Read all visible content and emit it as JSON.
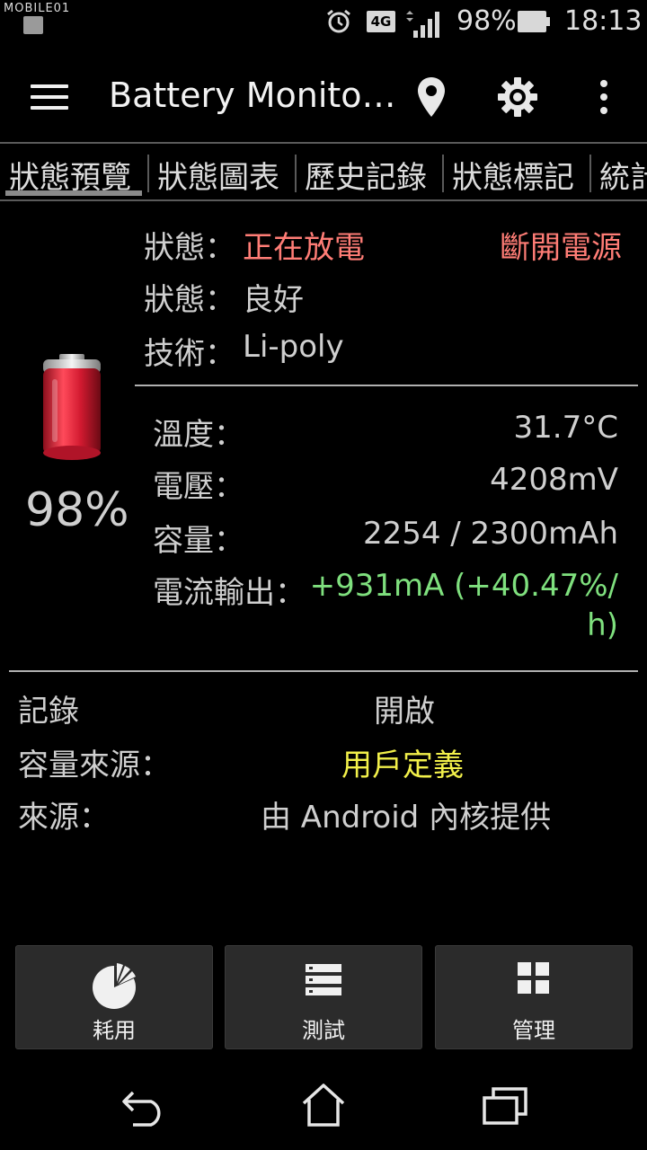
{
  "status_bar": {
    "watermark": "MOBILE01",
    "signal": "4G",
    "battery_percent": "98%",
    "time": "18:13"
  },
  "action_bar": {
    "title": "Battery Monito…",
    "icons": [
      "menu-icon",
      "location-icon",
      "gear-icon",
      "more-vert-icon"
    ]
  },
  "tabs": [
    {
      "label": "狀態預覽",
      "selected": true
    },
    {
      "label": "狀態圖表",
      "selected": false
    },
    {
      "label": "歷史記錄",
      "selected": false
    },
    {
      "label": "狀態標記",
      "selected": false
    },
    {
      "label": "統計",
      "selected": false
    }
  ],
  "overview": {
    "status_label": "狀態：",
    "status_value": "正在放電",
    "power_state": "斷開電源",
    "health_label": "狀態：",
    "health_value": "良好",
    "tech_label": "技術：",
    "tech_value": "Li-poly",
    "level": "98%",
    "temp_label": "溫度：",
    "temp_value": "31.7°C",
    "voltage_label": "電壓：",
    "voltage_value": "4208mV",
    "capacity_label": "容量：",
    "capacity_value": "2254 / 2300mAh",
    "current_label": "電流輸出：",
    "current_value_line1": "+931mA (+40.47%/",
    "current_value_line2": "h)"
  },
  "info": {
    "log_label": "記錄",
    "log_value": "開啟",
    "cap_source_label": "容量來源：",
    "cap_source_value": "用戶定義",
    "source_label": "來源：",
    "source_value": "由 Android 內核提供"
  },
  "buttons": [
    {
      "label": "耗用",
      "icon": "pie-chart-icon"
    },
    {
      "label": "測試",
      "icon": "list-icon"
    },
    {
      "label": "管理",
      "icon": "grid-icon"
    }
  ],
  "colors": {
    "discharging": "#ff7d76",
    "current": "#7fe07e",
    "user_defined": "#f2f04a"
  }
}
